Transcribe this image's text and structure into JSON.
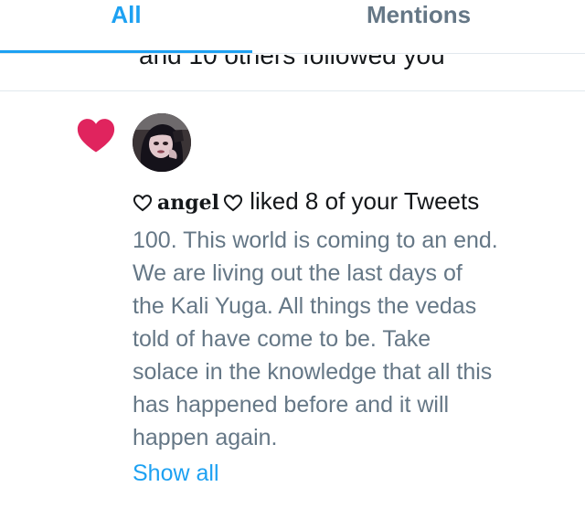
{
  "tabs": {
    "all_label": "All",
    "mentions_label": "Mentions",
    "active": "All"
  },
  "previous_item": {
    "text": "and 10 others followed you"
  },
  "notification": {
    "icon": "heart-icon",
    "avatar": "avatar",
    "user": {
      "prefix_icon": "outline-heart-icon",
      "name": "angel",
      "suffix_icon": "outline-heart-icon"
    },
    "action_text": "liked 8 of your Tweets",
    "tweet_text": "100. This world is coming to an end.\nWe are living out the last days of\nthe Kali Yuga. All things the vedas\ntold of have come to be. Take\nsolace in the knowledge that all this\nhas happened before and it will\nhappen again.",
    "show_all_label": "Show all"
  },
  "colors": {
    "accent": "#1da1f2",
    "like": "#e0245e",
    "secondary_text": "#657786",
    "primary_text": "#14171a",
    "divider": "#e1e8ed"
  }
}
